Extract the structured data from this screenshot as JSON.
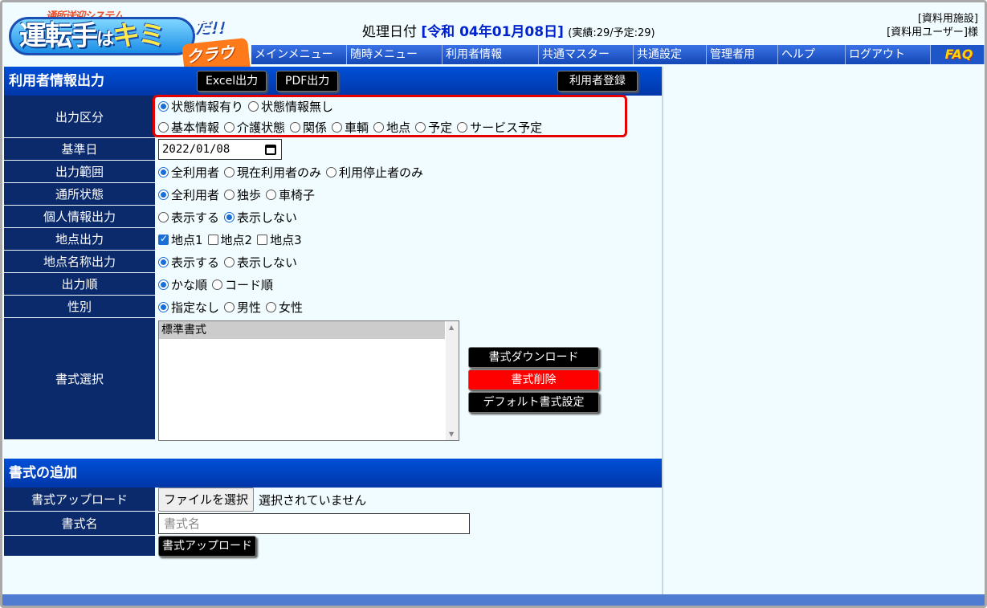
{
  "header": {
    "logo": {
      "subtitle": "通所送迎システム",
      "part1": "運転手",
      "part2": "は",
      "part3": "キミ",
      "part4": "だ!!",
      "cloud": "クラウド"
    },
    "proc_label": "処理日付",
    "proc_date": "[令和 04年01月08日]",
    "proc_counts": "(実績:29/予定:29)",
    "facility": "[資料用施設]",
    "user": "[資料用ユーザー]様"
  },
  "nav": {
    "items": [
      "メインメニュー",
      "随時メニュー",
      "利用者情報",
      "共通マスター",
      "共通設定",
      "管理者用",
      "ヘルプ",
      "ログアウト"
    ],
    "faq": "FAQ"
  },
  "section1": {
    "title": "利用者情報出力",
    "excel_btn": "Excel出力",
    "pdf_btn": "PDF出力",
    "register_btn": "利用者登録"
  },
  "form": {
    "output_type": {
      "label": "出力区分",
      "row1": [
        {
          "text": "状態情報有り",
          "checked": true
        },
        {
          "text": "状態情報無し",
          "checked": false
        }
      ],
      "row2": [
        {
          "text": "基本情報",
          "checked": false
        },
        {
          "text": "介護状態",
          "checked": false
        },
        {
          "text": "関係",
          "checked": false
        },
        {
          "text": "車輌",
          "checked": false
        },
        {
          "text": "地点",
          "checked": false
        },
        {
          "text": "予定",
          "checked": false
        },
        {
          "text": "サービス予定",
          "checked": false
        }
      ]
    },
    "base_date": {
      "label": "基準日",
      "value": "2022/01/08"
    },
    "output_range": {
      "label": "出力範囲",
      "options": [
        {
          "text": "全利用者",
          "checked": true
        },
        {
          "text": "現在利用者のみ",
          "checked": false
        },
        {
          "text": "利用停止者のみ",
          "checked": false
        }
      ]
    },
    "commute_status": {
      "label": "通所状態",
      "options": [
        {
          "text": "全利用者",
          "checked": true
        },
        {
          "text": "独歩",
          "checked": false
        },
        {
          "text": "車椅子",
          "checked": false
        }
      ]
    },
    "personal_info": {
      "label": "個人情報出力",
      "options": [
        {
          "text": "表示する",
          "checked": false
        },
        {
          "text": "表示しない",
          "checked": true
        }
      ]
    },
    "point_output": {
      "label": "地点出力",
      "options": [
        {
          "text": "地点1",
          "checked": true
        },
        {
          "text": "地点2",
          "checked": false
        },
        {
          "text": "地点3",
          "checked": false
        }
      ]
    },
    "point_name_output": {
      "label": "地点名称出力",
      "options": [
        {
          "text": "表示する",
          "checked": true
        },
        {
          "text": "表示しない",
          "checked": false
        }
      ]
    },
    "output_order": {
      "label": "出力順",
      "options": [
        {
          "text": "かな順",
          "checked": true
        },
        {
          "text": "コード順",
          "checked": false
        }
      ]
    },
    "gender": {
      "label": "性別",
      "options": [
        {
          "text": "指定なし",
          "checked": true
        },
        {
          "text": "男性",
          "checked": false
        },
        {
          "text": "女性",
          "checked": false
        }
      ]
    },
    "format_select": {
      "label": "書式選択",
      "items": [
        "標準書式"
      ],
      "download_btn": "書式ダウンロード",
      "delete_btn": "書式削除",
      "default_btn": "デフォルト書式設定"
    }
  },
  "section2": {
    "title": "書式の追加",
    "upload_label": "書式アップロード",
    "file_btn": "ファイルを選択",
    "file_status": "選択されていません",
    "name_label": "書式名",
    "name_placeholder": "書式名",
    "upload_btn": "書式アップロード"
  }
}
